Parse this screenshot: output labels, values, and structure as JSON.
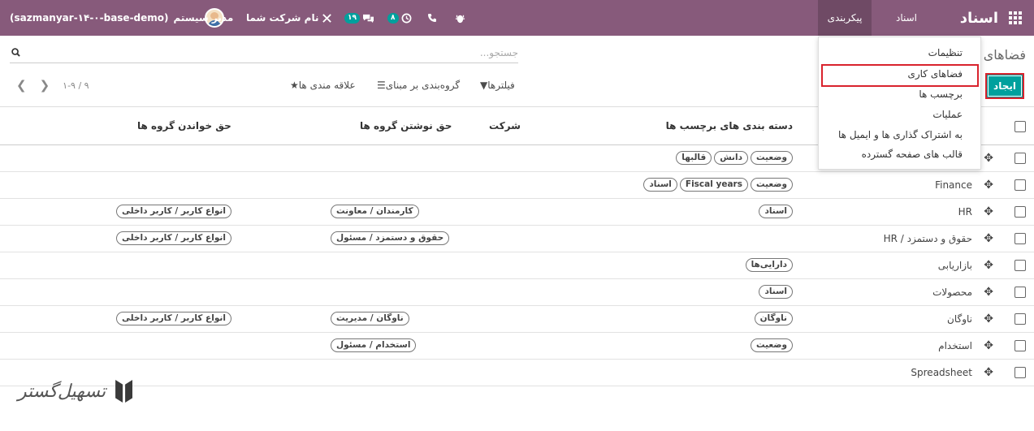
{
  "navbar": {
    "brand": "اسناد",
    "menu_documents": "اسناد",
    "menu_configuration": "پیکربندی",
    "debug_icon": "bug-icon",
    "phone_icon": "phone-icon",
    "activity_badge": "۸",
    "messages_badge": "۱۹",
    "company_name": "نام شرکت شما",
    "user_name": "مدیر سیستم",
    "database": "(sazmanyar-۱۴-۰-base-demo)",
    "colors": {
      "bar": "#875a7b",
      "active_menu": "#6f4a65",
      "badge": "#00a09d"
    }
  },
  "control_panel": {
    "title": "فضاهای",
    "create_label": "ایجاد",
    "search_placeholder": "جستجو...",
    "filters_label": "فیلترها",
    "groupby_label": "گروه‌بندی بر مبنای",
    "favorites_label": "علاقه مندی ها",
    "pager_value": "۱-۹ / ۹",
    "colors": {
      "create": "#00a09d",
      "highlight": "#d9232d"
    }
  },
  "dropdown": {
    "items": [
      "تنظیمات",
      "فضاهای کاری",
      "برچسب ها",
      "عملیات",
      "به اشتراک گذاری ها و ایمیل ها",
      "قالب های صفحه گسترده"
    ],
    "highlighted_index": 1
  },
  "table": {
    "columns": [
      "دسته بندی های برچسب ها",
      "شرکت",
      "حق نوشتن گروه ها",
      "حق خواندن گروه ها"
    ],
    "rows": [
      {
        "name": "",
        "categories": [
          "وضعیت",
          "دانش",
          "قالبها"
        ],
        "write": [],
        "read": []
      },
      {
        "name": "Finance",
        "categories": [
          "وضعیت",
          "Fiscal years",
          "اسناد"
        ],
        "write": [],
        "read": []
      },
      {
        "name": "HR",
        "categories": [
          "اسناد"
        ],
        "write": [
          "کارمندان / معاونت"
        ],
        "read": [
          "انواع کاربر / کاربر داخلی"
        ]
      },
      {
        "name": "HR / حقوق و دستمزد",
        "categories": [],
        "write": [
          "حقوق و دستمزد / مسئول"
        ],
        "read": [
          "انواع کاربر / کاربر داخلی"
        ]
      },
      {
        "name": "بازاریابی",
        "categories": [
          "دارایی‌ها"
        ],
        "write": [],
        "read": []
      },
      {
        "name": "محصولات",
        "categories": [
          "اسناد"
        ],
        "write": [],
        "read": []
      },
      {
        "name": "ناوگان",
        "categories": [
          "ناوگان"
        ],
        "write": [
          "ناوگان / مدیریت"
        ],
        "read": [
          "انواع کاربر / کاربر داخلی"
        ]
      },
      {
        "name": "استخدام",
        "categories": [
          "وضعیت"
        ],
        "write": [
          "استخدام / مسئول"
        ],
        "read": []
      },
      {
        "name": "Spreadsheet",
        "categories": [],
        "write": [],
        "read": []
      }
    ]
  },
  "watermark": {
    "text": "تسهیل‌گستر"
  }
}
